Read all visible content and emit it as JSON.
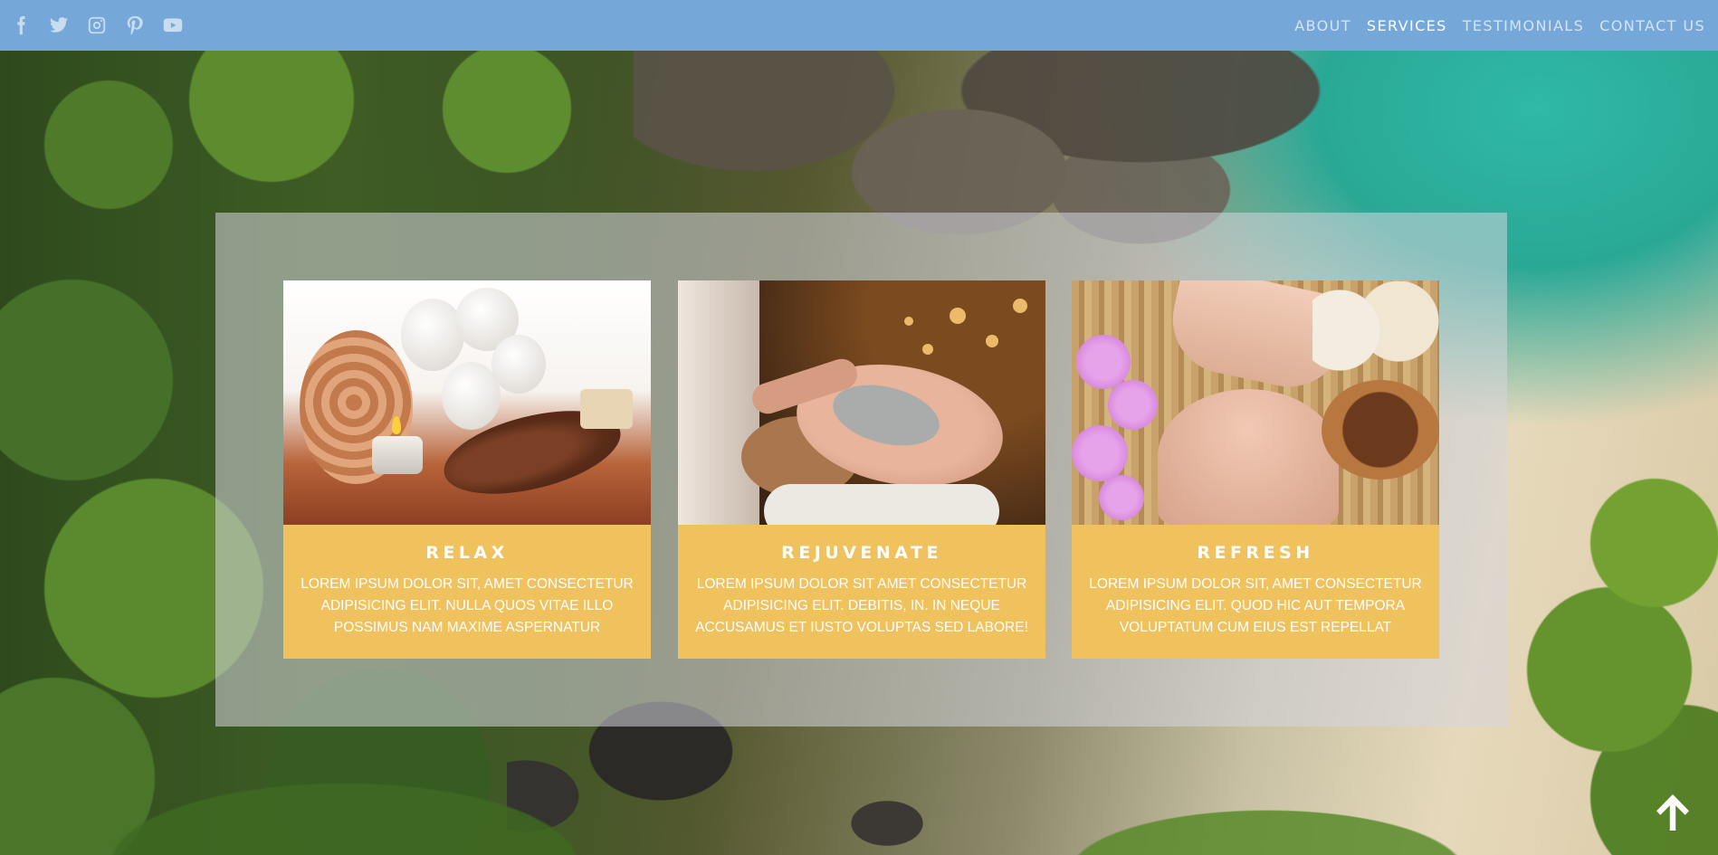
{
  "social": {
    "icons": [
      "facebook-icon",
      "twitter-icon",
      "instagram-icon",
      "pinterest-icon",
      "youtube-icon"
    ],
    "color": "#c9ddf1"
  },
  "nav": {
    "items": [
      {
        "label": "ABOUT",
        "active": false
      },
      {
        "label": "SERVICES",
        "active": true
      },
      {
        "label": "TESTIMONIALS",
        "active": false
      },
      {
        "label": "CONTACT US",
        "active": false
      }
    ]
  },
  "theme": {
    "topbar": "#75a7d8",
    "card": "#efc25e",
    "text": "#ffffff"
  },
  "services": [
    {
      "title": "RELAX",
      "text": "LOREM IPSUM DOLOR SIT, AMET CONSECTETUR ADIPISICING ELIT. NULLA QUOS VITAE ILLO POSSIMUS NAM MAXIME ASPERNATUR"
    },
    {
      "title": "REJUVENATE",
      "text": "LOREM IPSUM DOLOR SIT AMET CONSECTETUR ADIPISICING ELIT. DEBITIS, IN. IN NEQUE ACCUSAMUS ET IUSTO VOLUPTAS SED LABORE!"
    },
    {
      "title": "REFRESH",
      "text": "LOREM IPSUM DOLOR SIT, AMET CONSECTETUR ADIPISICING ELIT. QUOD HIC AUT TEMPORA VOLUPTATUM CUM EIUS EST REPELLAT"
    }
  ],
  "back_to_top": {
    "icon": "arrow-up-icon"
  }
}
